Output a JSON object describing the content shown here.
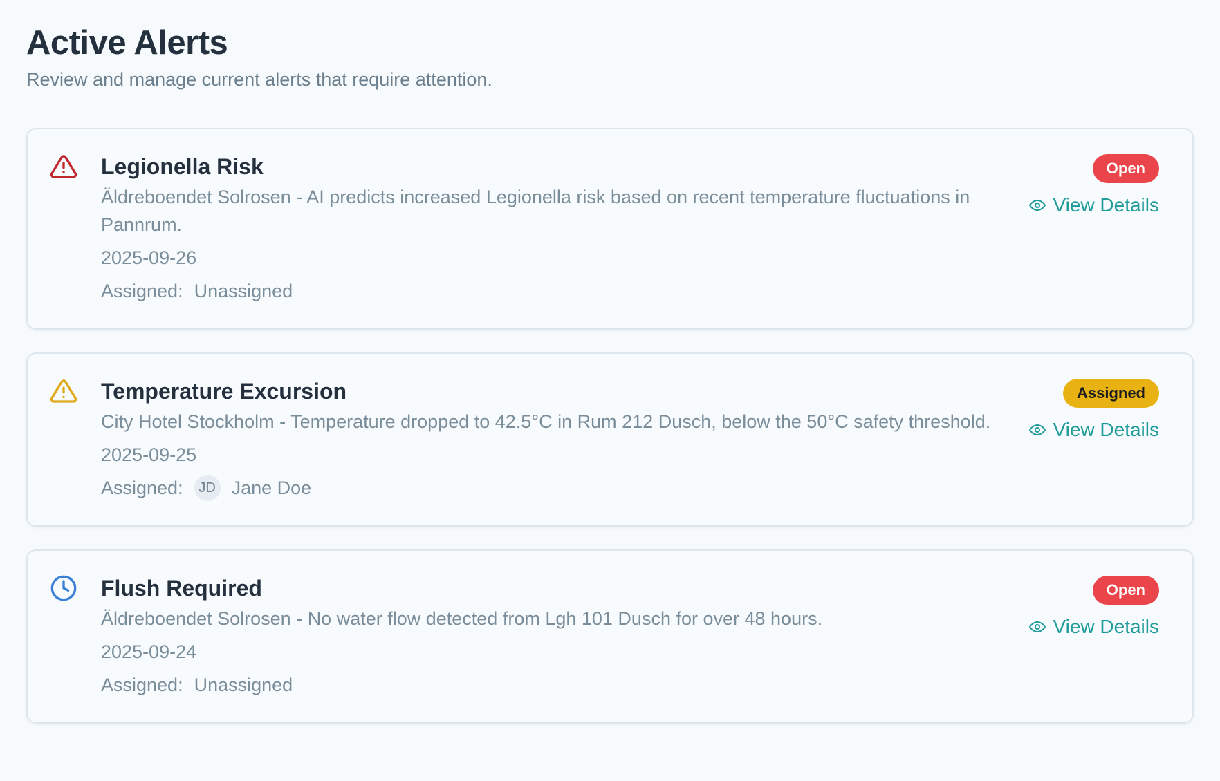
{
  "header": {
    "title": "Active Alerts",
    "subtitle": "Review and manage current alerts that require attention."
  },
  "colors": {
    "page_background": "#f6fafc",
    "card_border": "#dde6ec",
    "open_badge": "#e9454a",
    "assigned_badge": "#e8b312",
    "link": "#1f9b9a",
    "danger_icon": "#c0282e",
    "warning_icon": "#e0a91a",
    "clock_icon": "#3a7fd6"
  },
  "alerts": [
    {
      "icon": "alert-triangle-icon",
      "title": "Legionella Risk",
      "description": "Äldreboendet Solrosen - AI predicts increased Legionella risk based on recent temperature fluctuations in Pannrum.",
      "date": "2025-09-26",
      "assigned_label": "Assigned:",
      "assignee": "Unassigned",
      "status": "Open",
      "action_label": "View Details"
    },
    {
      "icon": "warning-triangle-icon",
      "title": "Temperature Excursion",
      "description": "City Hotel Stockholm - Temperature dropped to 42.5°C in Rum 212 Dusch, below the 50°C safety threshold.",
      "date": "2025-09-25",
      "assigned_label": "Assigned:",
      "assignee_initials": "JD",
      "assignee": "Jane Doe",
      "status": "Assigned",
      "action_label": "View Details"
    },
    {
      "icon": "clock-icon",
      "title": "Flush Required",
      "description": "Äldreboendet Solrosen - No water flow detected from Lgh 101 Dusch for over 48 hours.",
      "date": "2025-09-24",
      "assigned_label": "Assigned:",
      "assignee": "Unassigned",
      "status": "Open",
      "action_label": "View Details"
    }
  ]
}
